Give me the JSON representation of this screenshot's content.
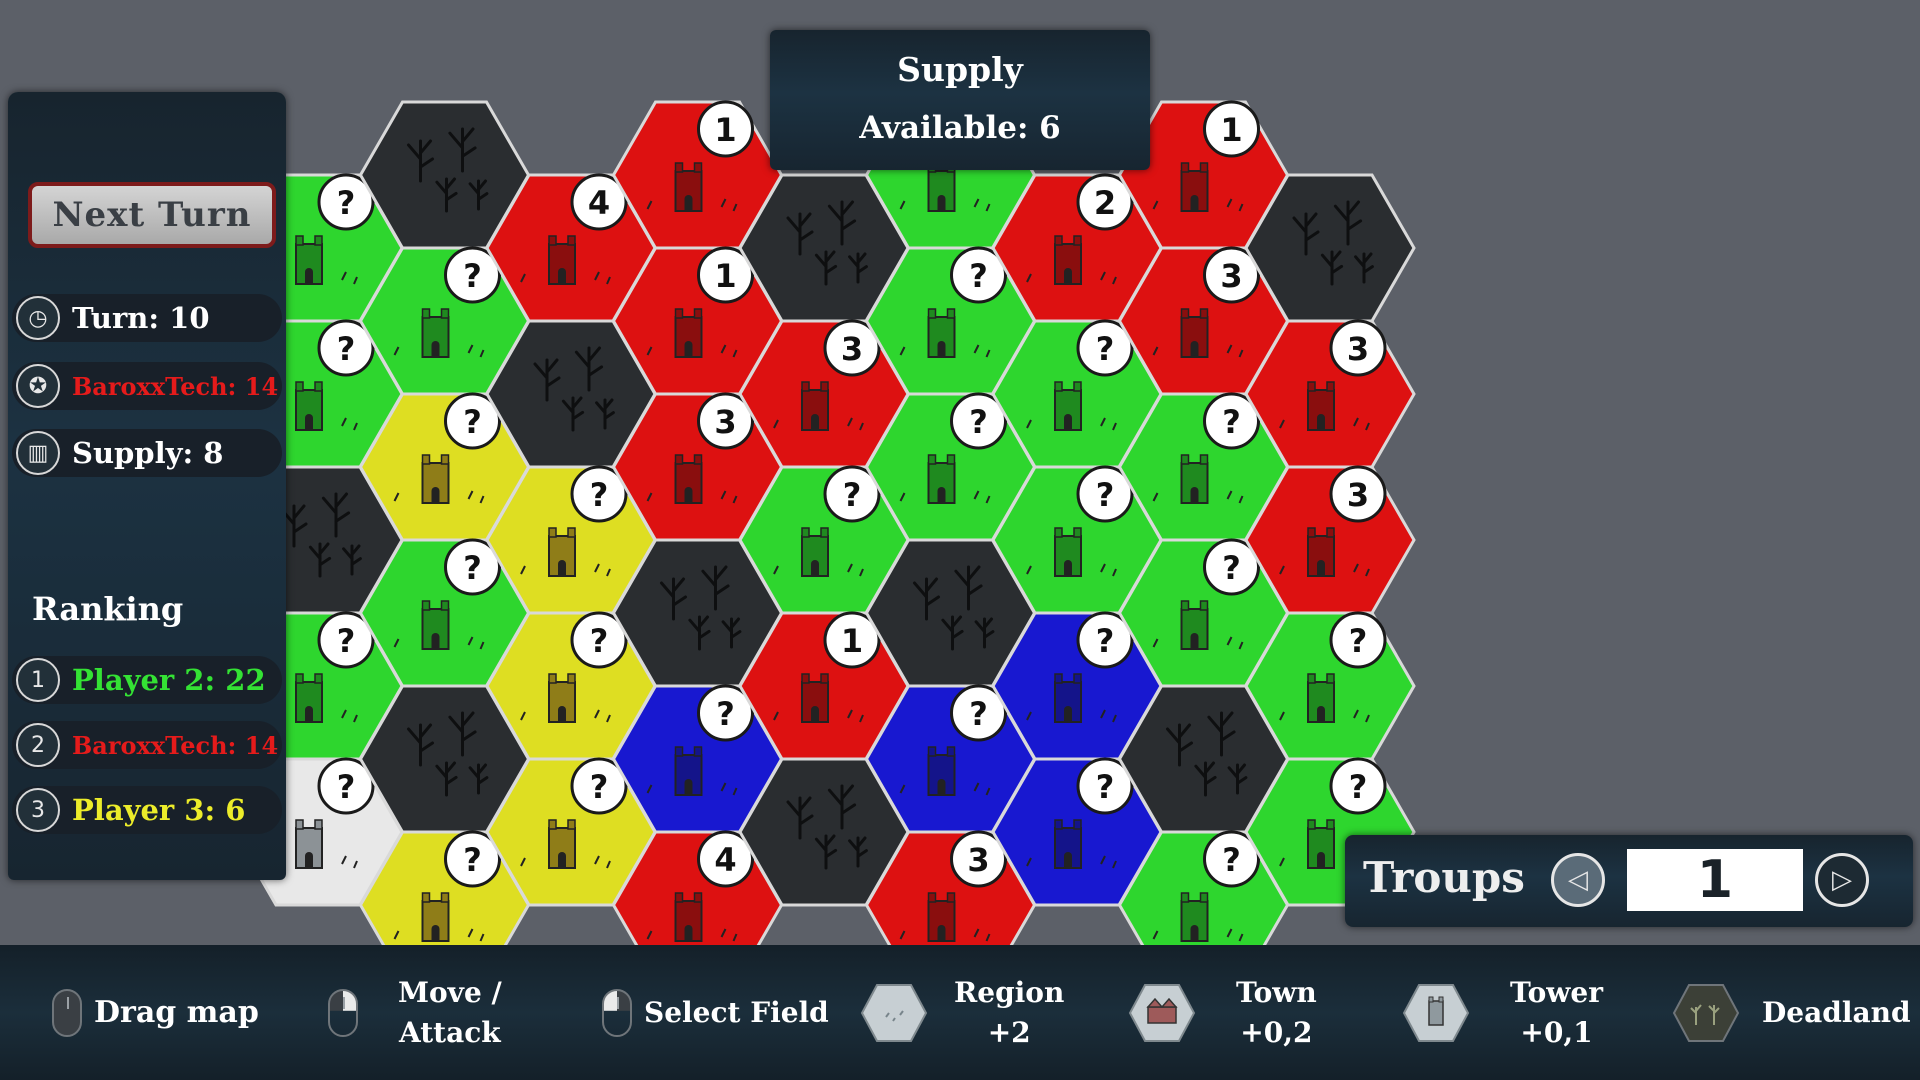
{
  "colors": {
    "red": "#dd1111",
    "green": "#2ed62e",
    "yellow": "#dede22",
    "blue": "#1818d0",
    "dead": "#2a2d30",
    "white": "#e8e8e8"
  },
  "hud": {
    "next_turn_label": "Next Turn",
    "turn": "Turn: 10",
    "player_score": "BaroxxTech: 14",
    "supply": "Supply: 8",
    "ranking_title": "Ranking",
    "ranking": [
      {
        "rank": "1",
        "text": "Player 2: 22",
        "color": "green"
      },
      {
        "rank": "2",
        "text": "BaroxxTech: 14",
        "color": "red"
      },
      {
        "rank": "3",
        "text": "Player 3: 6",
        "color": "yellow"
      }
    ]
  },
  "supply_box": {
    "title": "Supply",
    "available": "Available: 6"
  },
  "troups": {
    "label": "Troups",
    "value": "1"
  },
  "legend": {
    "drag_map": "Drag map",
    "move_attack_1": "Move /",
    "move_attack_2": "Attack",
    "select_field": "Select Field",
    "region": "Region",
    "region_bonus": "+2",
    "town": "Town",
    "town_bonus": "+0,2",
    "tower": "Tower",
    "tower_bonus": "+0,1",
    "deadland": "Deadland"
  },
  "map": {
    "tiles": [
      {
        "col": 0,
        "row": 0,
        "owner": "green",
        "label": "?"
      },
      {
        "col": 0,
        "row": 1,
        "owner": "green",
        "label": "?"
      },
      {
        "col": 0,
        "row": 2,
        "owner": "dead",
        "label": ""
      },
      {
        "col": 0,
        "row": 3,
        "owner": "green",
        "label": "?"
      },
      {
        "col": 0,
        "row": 4,
        "owner": "white",
        "label": "?"
      },
      {
        "col": 1,
        "row": 0,
        "owner": "dead",
        "label": ""
      },
      {
        "col": 1,
        "row": 1,
        "owner": "green",
        "label": "?"
      },
      {
        "col": 1,
        "row": 2,
        "owner": "yellow",
        "label": "?"
      },
      {
        "col": 1,
        "row": 3,
        "owner": "green",
        "label": "?"
      },
      {
        "col": 1,
        "row": 4,
        "owner": "dead",
        "label": ""
      },
      {
        "col": 1,
        "row": 5,
        "owner": "yellow",
        "label": "?"
      },
      {
        "col": 2,
        "row": 0,
        "owner": "red",
        "label": "4"
      },
      {
        "col": 2,
        "row": 1,
        "owner": "dead",
        "label": ""
      },
      {
        "col": 2,
        "row": 2,
        "owner": "yellow",
        "label": "?"
      },
      {
        "col": 2,
        "row": 3,
        "owner": "yellow",
        "label": "?"
      },
      {
        "col": 2,
        "row": 4,
        "owner": "yellow",
        "label": "?"
      },
      {
        "col": 3,
        "row": 0,
        "owner": "red",
        "label": "1"
      },
      {
        "col": 3,
        "row": 1,
        "owner": "red",
        "label": "1"
      },
      {
        "col": 3,
        "row": 2,
        "owner": "red",
        "label": "3"
      },
      {
        "col": 3,
        "row": 3,
        "owner": "dead",
        "label": ""
      },
      {
        "col": 3,
        "row": 4,
        "owner": "blue",
        "label": "?"
      },
      {
        "col": 3,
        "row": 5,
        "owner": "red",
        "label": "4"
      },
      {
        "col": 4,
        "row": 0,
        "owner": "dead",
        "label": ""
      },
      {
        "col": 4,
        "row": 1,
        "owner": "red",
        "label": "3"
      },
      {
        "col": 4,
        "row": 2,
        "owner": "green",
        "label": "?"
      },
      {
        "col": 4,
        "row": 3,
        "owner": "red",
        "label": "1"
      },
      {
        "col": 4,
        "row": 4,
        "owner": "dead",
        "label": ""
      },
      {
        "col": 5,
        "row": 0,
        "owner": "green",
        "label": "?"
      },
      {
        "col": 5,
        "row": 1,
        "owner": "green",
        "label": "?"
      },
      {
        "col": 5,
        "row": 2,
        "owner": "green",
        "label": "?"
      },
      {
        "col": 5,
        "row": 3,
        "owner": "dead",
        "label": ""
      },
      {
        "col": 5,
        "row": 4,
        "owner": "blue",
        "label": "?"
      },
      {
        "col": 5,
        "row": 5,
        "owner": "red",
        "label": "3"
      },
      {
        "col": 6,
        "row": 0,
        "owner": "red",
        "label": "2"
      },
      {
        "col": 6,
        "row": 1,
        "owner": "green",
        "label": "?"
      },
      {
        "col": 6,
        "row": 2,
        "owner": "green",
        "label": "?"
      },
      {
        "col": 6,
        "row": 3,
        "owner": "blue",
        "label": "?"
      },
      {
        "col": 6,
        "row": 4,
        "owner": "blue",
        "label": "?"
      },
      {
        "col": 7,
        "row": 0,
        "owner": "red",
        "label": "1"
      },
      {
        "col": 7,
        "row": 1,
        "owner": "red",
        "label": "3"
      },
      {
        "col": 7,
        "row": 2,
        "owner": "green",
        "label": "?"
      },
      {
        "col": 7,
        "row": 3,
        "owner": "green",
        "label": "?"
      },
      {
        "col": 7,
        "row": 4,
        "owner": "dead",
        "label": ""
      },
      {
        "col": 7,
        "row": 5,
        "owner": "green",
        "label": "?"
      },
      {
        "col": 8,
        "row": 0,
        "owner": "dead",
        "label": ""
      },
      {
        "col": 8,
        "row": 1,
        "owner": "red",
        "label": "3"
      },
      {
        "col": 8,
        "row": 2,
        "owner": "red",
        "label": "3"
      },
      {
        "col": 8,
        "row": 3,
        "owner": "green",
        "label": "?"
      },
      {
        "col": 8,
        "row": 4,
        "owner": "green",
        "label": "?"
      }
    ]
  }
}
